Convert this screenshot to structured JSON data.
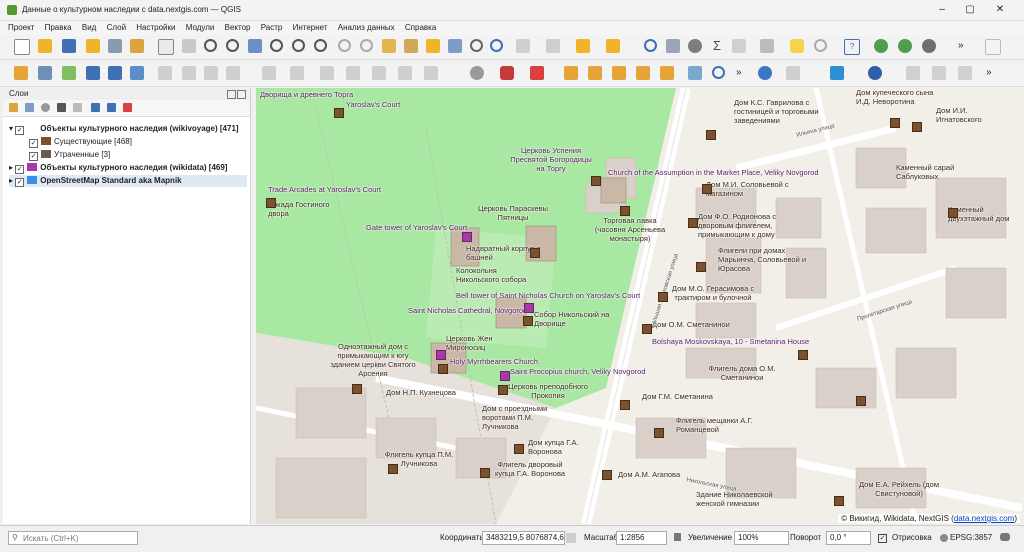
{
  "window": {
    "title": "Данные о культурном наследии с data.nextgis.com — QGIS",
    "minimize": "–",
    "maximize": "▢",
    "close": "✕"
  },
  "menu": [
    "Проект",
    "Правка",
    "Вид",
    "Слой",
    "Настройки",
    "Модули",
    "Вектор",
    "Растр",
    "Интернет",
    "Анализ данных",
    "Справка"
  ],
  "layers_panel": {
    "title": "Слои",
    "layers": [
      {
        "label": "Объекты культурного наследия (wikivoyage) [471]",
        "bold": true
      },
      {
        "label": "Существующие [468]",
        "bold": false
      },
      {
        "label": "Утраченные [3]",
        "bold": false
      },
      {
        "label": "Объекты культурного наследия (wikidata) [469]",
        "bold": true
      },
      {
        "label": "OpenStreetMap Standard aka Mapnik",
        "bold": true
      }
    ]
  },
  "map": {
    "labels": [
      "Дворища и древнего Торга",
      "Yaroslav's Court",
      "Дом К.С. Гаврилова с гостиницей и торговыми заведениями",
      "Дом купеческого сына И.Д. Неворотина",
      "Дом И.И. Игнатовского",
      "Церковь Успения Пресвятой Богородицы на Торгу",
      "Church of the Assumption in the Market Place, Veliky Novgorod",
      "Дом М.И. Соловьевой с магазином",
      "Каменный сарай Саблуковых",
      "Trade Arcades at Yaroslav's Court",
      "Аркада Гостиного двора",
      "Церковь Параскевы Пятницы",
      "Торговая лавка (часовня Арсеньева монастыря)",
      "Дом Ф.О. Родионова с дворовым флигелем, примыкающим к дому",
      "Каменный двухэтажный дом",
      "Gate tower of Yaroslav's Court",
      "Надвратный корпус с башней",
      "Флигели при домах Марьинна, Соловьевой и Юрасова",
      "Колокольня Никольского собора",
      "Bell tower of Saint Nicholas Church on Yaroslav's Court",
      "Дом М.О. Герасимова с трактиром и булочной",
      "Saint Nicholas Cathedral, Novgorod",
      "Собор Никольский на Дворище",
      "Дом О.М. Сметанинои",
      "Одноэтажный дом с примыкающим к югу зданием церкви Святого Арсения",
      "Церковь Жен Мироносиц",
      "Bolshaya Moskovskaya, 10 - Smetanina House",
      "Holy Myrrhbearers Church",
      "Saint Procopius church, Veliky Novgorod",
      "Флигель дома О.М. Сметанинои",
      "Церковь преподобного Прокопия",
      "Дом Н.П. Кузнецова",
      "Дом Г.М. Сметанина",
      "Дом с проездными воротами П.М. Лучникова",
      "Флигель мещанки А.Г. Романцевой",
      "Дом купца Г.А. Воронова",
      "Флигель купца П.М. Лучникова",
      "Флигель дворовый купца Г.А. Воронова",
      "Дом А.М. Агапова",
      "Здание Николаевской женской гимназии",
      "Дом Е.А. Рейхель (дом Свистуновой)"
    ],
    "street_labels": [
      "Большая Московская улица",
      "Ильина улица",
      "Никольская улица",
      "Пролетарская улица"
    ],
    "attribution": {
      "text": "© Викигид, Wikidata, NextGIS (",
      "link": "data.nextgis.com",
      "end": ")"
    }
  },
  "statusbar": {
    "search_placeholder": "Искать (Ctrl+K)",
    "coords_label": "Координаты",
    "coords_value": "3483219,5  8076874,6",
    "scale_label": "Масштаб",
    "scale_value": "1:2856",
    "zoom_label": "Увеличение",
    "zoom_value": "100%",
    "rotation_label": "Поворот",
    "rotation_value": "0,0 °",
    "render_label": "Отрисовка",
    "crs_value": "EPSG:3857"
  },
  "colors": {
    "map_land": "#f2efe9",
    "park": "#8fdc8f",
    "road": "#ffffff",
    "building": "#d9d0c9",
    "heritage_marker": "#7a5230",
    "wikidata_marker": "#a73aa6",
    "accent": "#589632"
  }
}
